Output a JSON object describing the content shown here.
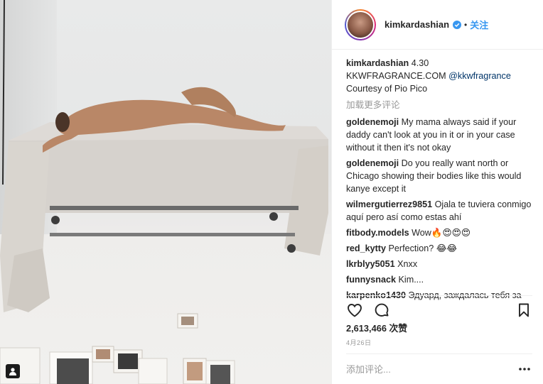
{
  "post": {
    "username": "kimkardashian",
    "dot": "•",
    "follow_label": "关注",
    "caption": {
      "username": "kimkardashian",
      "text_1": " 4.30",
      "text_2": "KKWFRAGRANCE.COM ",
      "mention": "@kkwfragrance",
      "text_3": "Courtesy of Pio Pico"
    },
    "load_more_label": "加载更多评论",
    "comments": [
      {
        "user": "goldenemoji",
        "text": " My mama always said if your daddy can't look at you in it or in your case without it then it's not okay"
      },
      {
        "user": "goldenemoji",
        "text": " Do you really want north or Chicago showing their bodies like this would kanye except it"
      },
      {
        "user": "wilmergutierrez9851",
        "text": " Ojala te tuviera conmigo aquí pero así como estas ahí"
      },
      {
        "user": "fitbody.models",
        "text": " Wow🔥😍😍😍"
      },
      {
        "user": "red_kytty",
        "text": " Perfection? 😂😂"
      },
      {
        "user": "lkrblyy5051",
        "text": " Xnxx"
      },
      {
        "user": "funnysnack",
        "text": " Kim...."
      },
      {
        "user": "karpenko1430",
        "text": " Эдуард, заждалась тебя за"
      }
    ],
    "likes": "2,613,466 次赞",
    "date": "4月26日",
    "add_comment_placeholder": "添加评论..."
  },
  "icons": {
    "verified": "verified-badge-icon",
    "like": "heart-icon",
    "comment": "comment-bubble-icon",
    "save": "bookmark-icon",
    "more": "more-dots-icon",
    "user_tag": "user-tag-icon"
  },
  "colors": {
    "accent": "#3897f0",
    "text": "#262626",
    "muted": "#999999",
    "mention": "#003569"
  }
}
